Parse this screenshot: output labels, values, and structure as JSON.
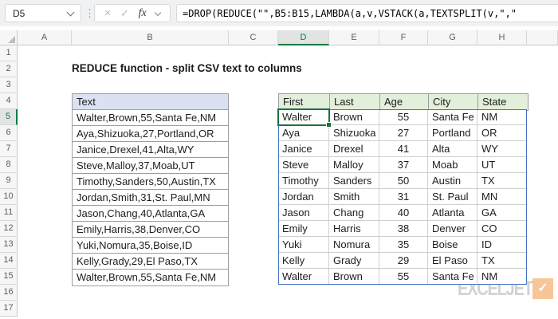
{
  "formula_bar": {
    "name_box_value": "D5",
    "separator_dots": "⋮",
    "cancel_icon": "×",
    "enter_icon": "✓",
    "fx_label": "fx",
    "formula": "=DROP(REDUCE(\"\",B5:B15,LAMBDA(a,v,VSTACK(a,TEXTSPLIT(v,\",\""
  },
  "sheet": {
    "title": "REDUCE function - split CSV text to columns",
    "column_headers": [
      "A",
      "B",
      "C",
      "D",
      "E",
      "F",
      "G",
      "H",
      ""
    ],
    "row_numbers": [
      "1",
      "2",
      "3",
      "4",
      "5",
      "6",
      "7",
      "8",
      "9",
      "10",
      "11",
      "12",
      "13",
      "14",
      "15",
      "16",
      "17"
    ],
    "selected_cell": "D5",
    "selected_column": "D",
    "selected_row": "5",
    "left_table": {
      "header": "Text",
      "rows": [
        "Walter,Brown,55,Santa Fe,NM",
        "Aya,Shizuoka,27,Portland,OR",
        "Janice,Drexel,41,Alta,WY",
        "Steve,Malloy,37,Moab,UT",
        "Timothy,Sanders,50,Austin,TX",
        "Jordan,Smith,31,St. Paul,MN",
        "Jason,Chang,40,Atlanta,GA",
        "Emily,Harris,38,Denver,CO",
        "Yuki,Nomura,35,Boise,ID",
        "Kelly,Grady,29,El Paso,TX",
        "Walter,Brown,55,Santa Fe,NM"
      ]
    },
    "right_table": {
      "headers": [
        "First",
        "Last",
        "Age",
        "City",
        "State"
      ],
      "rows": [
        [
          "Walter",
          "Brown",
          "55",
          "Santa Fe",
          "NM"
        ],
        [
          "Aya",
          "Shizuoka",
          "27",
          "Portland",
          "OR"
        ],
        [
          "Janice",
          "Drexel",
          "41",
          "Alta",
          "WY"
        ],
        [
          "Steve",
          "Malloy",
          "37",
          "Moab",
          "UT"
        ],
        [
          "Timothy",
          "Sanders",
          "50",
          "Austin",
          "TX"
        ],
        [
          "Jordan",
          "Smith",
          "31",
          "St. Paul",
          "MN"
        ],
        [
          "Jason",
          "Chang",
          "40",
          "Atlanta",
          "GA"
        ],
        [
          "Emily",
          "Harris",
          "38",
          "Denver",
          "CO"
        ],
        [
          "Yuki",
          "Nomura",
          "35",
          "Boise",
          "ID"
        ],
        [
          "Kelly",
          "Grady",
          "29",
          "El Paso",
          "TX"
        ],
        [
          "Walter",
          "Brown",
          "55",
          "Santa Fe",
          "NM"
        ]
      ]
    }
  },
  "watermark": {
    "text": "EXCELJET",
    "check": "✓"
  },
  "colors": {
    "selection_green": "#1a7240",
    "header_accent_green": "#107c41",
    "spill_blue": "#4472c4",
    "left_header_fill": "#d9e1f2",
    "right_header_fill": "#e2efda",
    "logo_orange": "#f5a35c"
  }
}
